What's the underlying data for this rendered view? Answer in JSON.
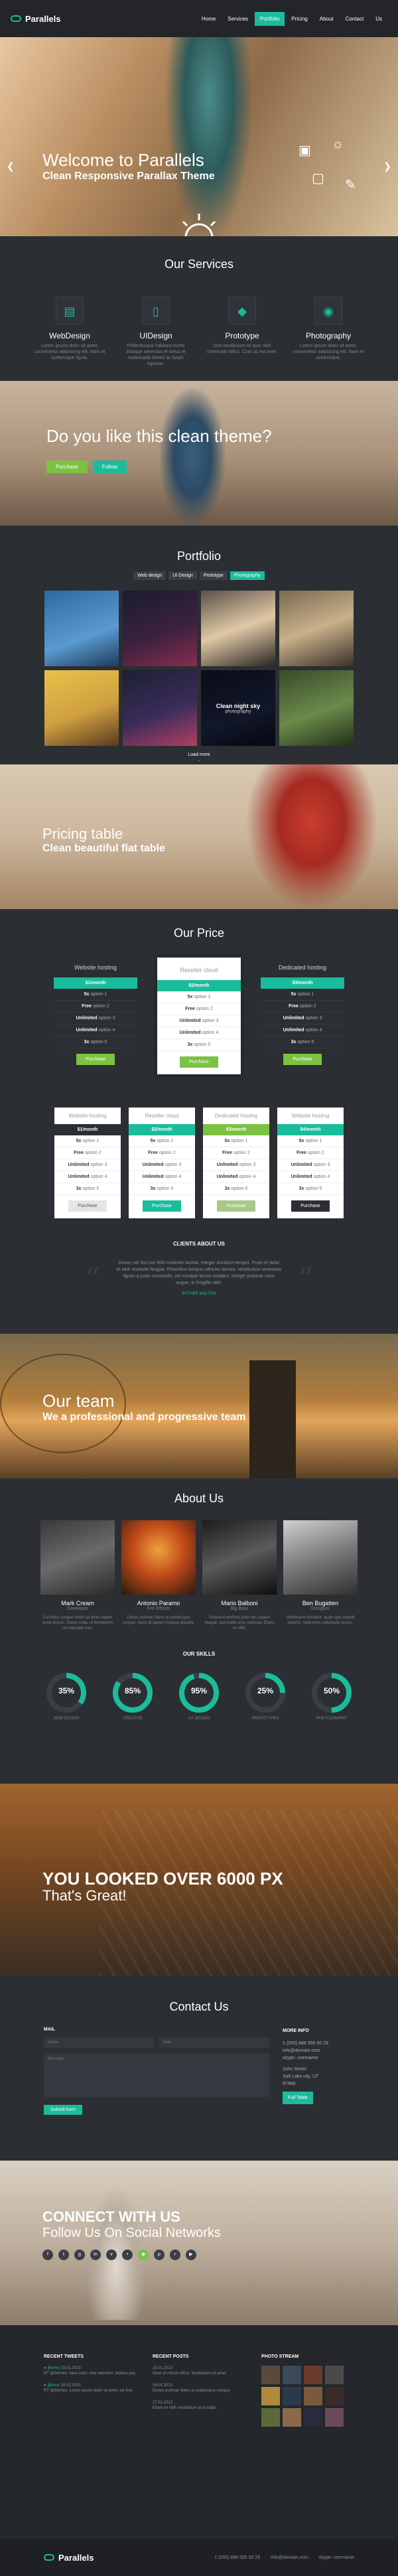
{
  "nav": {
    "brand": "Parallels",
    "items": [
      "Home",
      "Services",
      "Portfolio",
      "Pricing",
      "About",
      "Contact",
      "Us"
    ],
    "active_index": 2
  },
  "hero": {
    "title": "Welcome to Parallels",
    "subtitle": "Clean Responsive Parallax Theme"
  },
  "services": {
    "title": "Our Services",
    "items": [
      {
        "title": "WebDesign",
        "text": "Lorem ipsum dolor sit amet, consectetur adipiscing elit. Nam et scelerisque ligula."
      },
      {
        "title": "UIDesign",
        "text": "Pellentesque habitant morbi tristique senectus et netus et malesuada fames ac turpis egestas."
      },
      {
        "title": "Prototype",
        "text": "Sed vestibulum mi quis nibh commodo tellus. Cras ac est ante."
      },
      {
        "title": "Photography",
        "text": "Lorem ipsum dolor sit amet, consectetur adipiscing elit. Nam et scelerisque."
      }
    ]
  },
  "clean_theme": {
    "title": "Do you like this clean theme?",
    "purchase": "Purchase",
    "follow": "Follow"
  },
  "portfolio": {
    "title": "Portfolio",
    "filters": [
      "Web design",
      "UI Design",
      "Prototype",
      "Photography"
    ],
    "active_filter": 3,
    "overlay_title": "Clean night sky",
    "overlay_sub": "photography",
    "load_more": "Load more"
  },
  "pricing_parallax": {
    "title": "Pricing table",
    "subtitle": "Clean beautiful flat table"
  },
  "pricing": {
    "title": "Our Price",
    "plans": [
      {
        "name": "Website hosting",
        "price": "$1/month"
      },
      {
        "name": "Reseller cloud",
        "price": "$2/month"
      },
      {
        "name": "Dedicated hosting",
        "price": "$3/month"
      }
    ],
    "plans_small": [
      {
        "name": "Website hosting",
        "price": "$1/month"
      },
      {
        "name": "Reseller cloud",
        "price": "$2/month"
      },
      {
        "name": "Dedicated hosting",
        "price": "$3/month"
      },
      {
        "name": "Website hosting",
        "price": "$4/month"
      }
    ],
    "features": [
      {
        "b": "5x",
        "t": "option 1"
      },
      {
        "b": "Free",
        "t": "option 2"
      },
      {
        "b": "Unlimited",
        "t": "option 3"
      },
      {
        "b": "Unlimited",
        "t": "option 4"
      },
      {
        "b": "3x",
        "t": "option 5"
      }
    ],
    "purchase": "Purchase"
  },
  "clients": {
    "label": "CLIENTS ABOUT US",
    "quote": "Donec vel dui non felis molestie lacinia. Integer tincidunt tempor. Proin et dolor et nibh molestie feugiat. Phasellus tempus ultricies lacinia. Vestibulum venenatis ligula ut justo commodo, vel volutpat lectus sodales. Integer pulvinar nunc augue, in fringilla nibh.",
    "author": "BYTHER MOLTON"
  },
  "team_parallax": {
    "title": "Our team",
    "subtitle": "We a professional and progressive team"
  },
  "about": {
    "title": "About Us",
    "members": [
      {
        "name": "Mark Cream",
        "role": "Developer",
        "text": "Curabitur congue lorem sit amet sapien porta dictum. Donec nulla, ut fermentum mi vulputate non."
      },
      {
        "name": "Antonio Paramo",
        "role": "Fire Effects",
        "text": "Donec pulvinar libero at scelerisque congue. Nunc id sapien tristique gravida."
      },
      {
        "name": "Mario Balboni",
        "role": "Big Boss",
        "text": "Praesent eleifend justo nec sapien feugiat, sed mattis arcu vehicula. Etiam mi nibh."
      },
      {
        "name": "Ben Bugatten",
        "role": "Designer",
        "text": "Vestibulum tincidunt, quam quis blandit lobortis, nulla enim sollicitudin lectus."
      }
    ],
    "skills_label": "OUR SKILLS",
    "skills": [
      {
        "name": "WEB DESIGN",
        "value": 35,
        "label": "35%"
      },
      {
        "name": "CREATIVE",
        "value": 85,
        "label": "85%"
      },
      {
        "name": "UX DESIGN",
        "value": 95,
        "label": "95%"
      },
      {
        "name": "PROTOTYPES",
        "value": 25,
        "label": "25%"
      },
      {
        "name": "PHOTOGRAPHY",
        "value": 50,
        "label": "50%"
      }
    ]
  },
  "counter": {
    "title": "YOU LOOKED OVER 6000 PX",
    "subtitle": "That's Great!"
  },
  "contact": {
    "title": "Contact Us",
    "mail_label": "MAIL",
    "name_placeholder": "Name",
    "email_placeholder": "Mail",
    "message_placeholder": "Message",
    "submit": "Submit form",
    "info_label": "MORE INFO",
    "info": [
      "1 (555) 888 555 00 29",
      "info@domain.com",
      "skype: username",
      "John Street",
      "Salt Lake city, UT",
      "87986"
    ],
    "info_btn": "Full Table"
  },
  "social": {
    "title": "CONNECT WITH US",
    "subtitle": "Follow Us On Social Networks"
  },
  "footer": {
    "tweets_label": "RECENT TWEETS",
    "tweets": [
      {
        "name": "@envy",
        "date": "15.01.2013",
        "text": "RT @themes: New color, new selection, feature yes."
      },
      {
        "name": "@envy",
        "date": "18.02.2013",
        "text": "RT @themes: Lorem ipsum dolor sit amet, we fine."
      }
    ],
    "posts_label": "RECENT POSTS",
    "posts": [
      {
        "date": "15.01.2013",
        "text": "Nunc id rutrum tellus. Vestibulum sit amet."
      },
      {
        "date": "16.01.2013",
        "text": "Donec pulvinar libero at scelerisque congue."
      },
      {
        "date": "17.01.2013",
        "text": "Etiam mi nibh vestibulum at suscipit."
      }
    ],
    "photos_label": "PHOTO STREAM",
    "phone": "1 (555) 888 555 00 29",
    "email": "info@domain.com",
    "skype": "skype: username"
  },
  "colors": {
    "accent": "#1abc9c",
    "green": "#7cc242",
    "bg": "#2b2e33"
  }
}
